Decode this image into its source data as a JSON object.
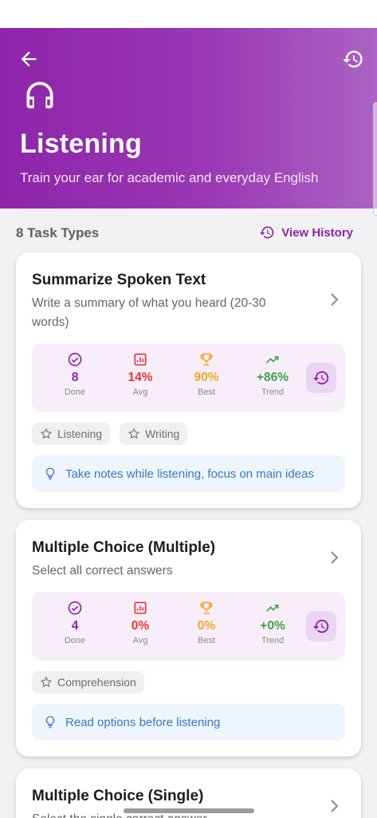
{
  "header": {
    "title": "Listening",
    "subtitle": "Train your ear for academic and everyday English",
    "icons": {
      "back": "arrow-left",
      "history": "history",
      "main": "headphones"
    },
    "gradient": [
      "#8e24aa",
      "#ab63c4"
    ]
  },
  "section": {
    "count_label": "8 Task Types",
    "history_link": "View History"
  },
  "cards": [
    {
      "title": "Summarize Spoken Text",
      "description": "Write a summary of what you heard (20-30 words)",
      "stats": {
        "done": "8",
        "avg": "14%",
        "best": "90%",
        "trend": "+86%",
        "done_label": "Done",
        "avg_label": "Avg",
        "best_label": "Best",
        "trend_label": "Trend"
      },
      "tags": [
        "Listening",
        "Writing"
      ],
      "tip": "Take notes while listening, focus on main ideas"
    },
    {
      "title": "Multiple Choice (Multiple)",
      "description": "Select all correct answers",
      "stats": {
        "done": "4",
        "avg": "0%",
        "best": "0%",
        "trend": "+0%",
        "done_label": "Done",
        "avg_label": "Avg",
        "best_label": "Best",
        "trend_label": "Trend"
      },
      "tags": [
        "Comprehension"
      ],
      "tip": "Read options before listening"
    },
    {
      "title": "Multiple Choice (Single)",
      "description": "Select the single correct answer"
    }
  ],
  "colors": {
    "primary": "#8e24aa",
    "avg": "#e53935",
    "best": "#f5a623",
    "trend": "#43a047",
    "tip_text": "#3a78c2"
  }
}
